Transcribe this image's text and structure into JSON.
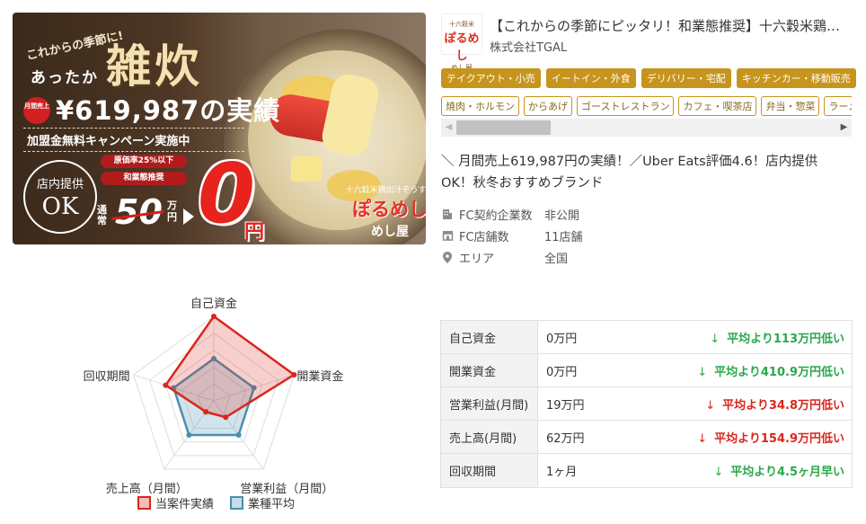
{
  "hero": {
    "tagline": "これからの季節に!",
    "atatta": "あったか",
    "product": "雑炊",
    "sales_badge": "月間売上",
    "sales": "¥619,987の実績",
    "campaign": "加盟金無料キャンペーン実施中",
    "store_offer": "店内提供",
    "ok": "OK",
    "pill1": "原価率25%以下",
    "pill2": "和業態推奨",
    "normal": "通常",
    "old_price": "50",
    "old_unit": "万円",
    "new_price": "0",
    "new_unit": "円",
    "brand_top": "十六穀米鶏出汁ぞうすい",
    "brand_mid": "ぽるめし",
    "brand_bot": "めし屋"
  },
  "header": {
    "logo_l1": "十六穀米",
    "logo_l2": "ぽるめし",
    "logo_l3": "めし屋",
    "title": "【これからの季節にピッタリ！和業態推奨】十六穀米鶏出汁ぞうすい専門店",
    "company": "株式会社TGAL"
  },
  "categories": [
    "テイクアウト・小売",
    "イートイン・外食",
    "デリバリー・宅配",
    "キッチンカー・移動販売"
  ],
  "tags": [
    "焼肉・ホルモン",
    "からあげ",
    "ゴーストレストラン",
    "カフェ・喫茶店",
    "弁当・惣菜",
    "ラーメン・つけ麺"
  ],
  "scroll": {
    "left_arrow": "◀",
    "right_arrow": "▶"
  },
  "headline": "＼ 月間売上619,987円の実績！／Uber Eats評価4.6！店内提供OK！秋冬おすすめブランド",
  "facts": [
    {
      "icon": "building-icon",
      "label": "FC契約企業数",
      "value": "非公開"
    },
    {
      "icon": "store-icon",
      "label": "FC店舗数",
      "value": "11店舗"
    },
    {
      "icon": "location-pin-icon",
      "label": "エリア",
      "value": "全国"
    }
  ],
  "chart_data": {
    "type": "radar",
    "axes": [
      "自己資金",
      "開業資金",
      "営業利益（月間）",
      "売上高（月間）",
      "回収期間"
    ],
    "scale": [
      0,
      5
    ],
    "series": [
      {
        "name": "当案件実績",
        "values": [
          5,
          5,
          1.2,
          0.8,
          3.0
        ],
        "color": "#d9261c"
      },
      {
        "name": "業種平均",
        "values": [
          2.5,
          2.5,
          2.5,
          2.5,
          2.5
        ],
        "color": "#4a8fb0"
      }
    ],
    "rings": 5,
    "legend": "bottom"
  },
  "comparison": [
    {
      "label": "自己資金",
      "value": "0万円",
      "diff": "平均より113万円低い",
      "arrow": "↓",
      "color": "green"
    },
    {
      "label": "開業資金",
      "value": "0万円",
      "diff": "平均より410.9万円低い",
      "arrow": "↓",
      "color": "green"
    },
    {
      "label": "営業利益(月間)",
      "value": "19万円",
      "diff": "平均より34.8万円低い",
      "arrow": "↓",
      "color": "red"
    },
    {
      "label": "売上高(月間)",
      "value": "62万円",
      "diff": "平均より154.9万円低い",
      "arrow": "↓",
      "color": "red"
    },
    {
      "label": "回収期間",
      "value": "1ヶ月",
      "diff": "平均より4.5ヶ月早い",
      "arrow": "↓",
      "color": "green"
    }
  ]
}
